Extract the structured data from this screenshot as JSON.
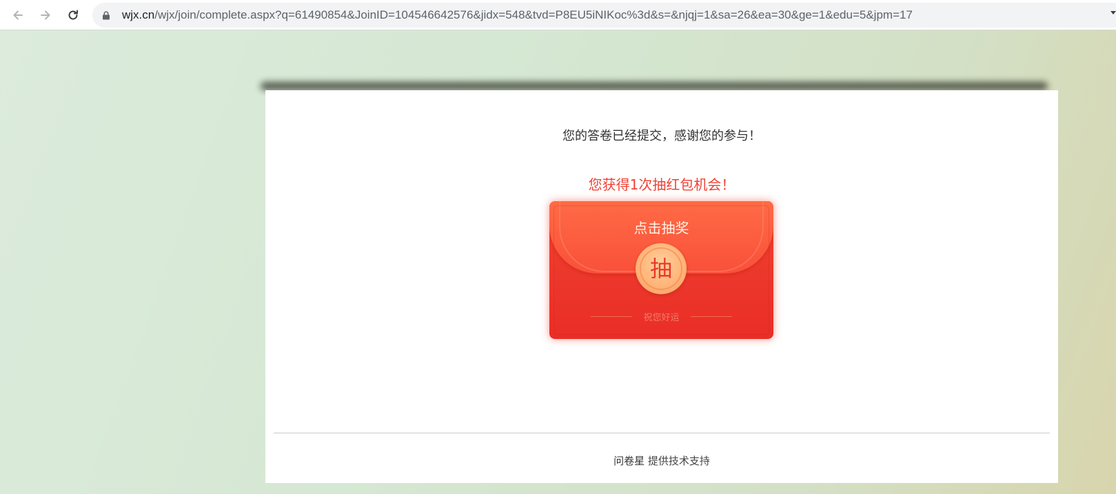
{
  "browser": {
    "url_host": "wjx.cn",
    "url_path": "/wjx/join/complete.aspx?q=61490854&JoinID=104546642576&jidx=548&tvd=P8EU5iNIKoc%3d&s=&njqj=1&sa=26&ea=30&ge=1&edu=5&jpm=17",
    "icons": [
      "back-arrow-icon",
      "forward-arrow-icon",
      "reload-icon",
      "lock-icon",
      "menu-caret-icon"
    ]
  },
  "page": {
    "thanks_message": "您的答卷已经提交，感谢您的参与！",
    "lottery_chance": "您获得1次抽红包机会！"
  },
  "red_packet": {
    "title": "点击抽奖",
    "button_label": "抽",
    "blessing": "祝您好运",
    "colors": {
      "body": "#ea2d27",
      "flap": "#ff6b45",
      "coin": "#ffb57a",
      "title_text": "#fff3e6"
    }
  },
  "footer": {
    "brand": "问卷星",
    "support_text": "提供技术支持"
  },
  "colors": {
    "accent_red": "#f04134",
    "text": "#333333"
  }
}
